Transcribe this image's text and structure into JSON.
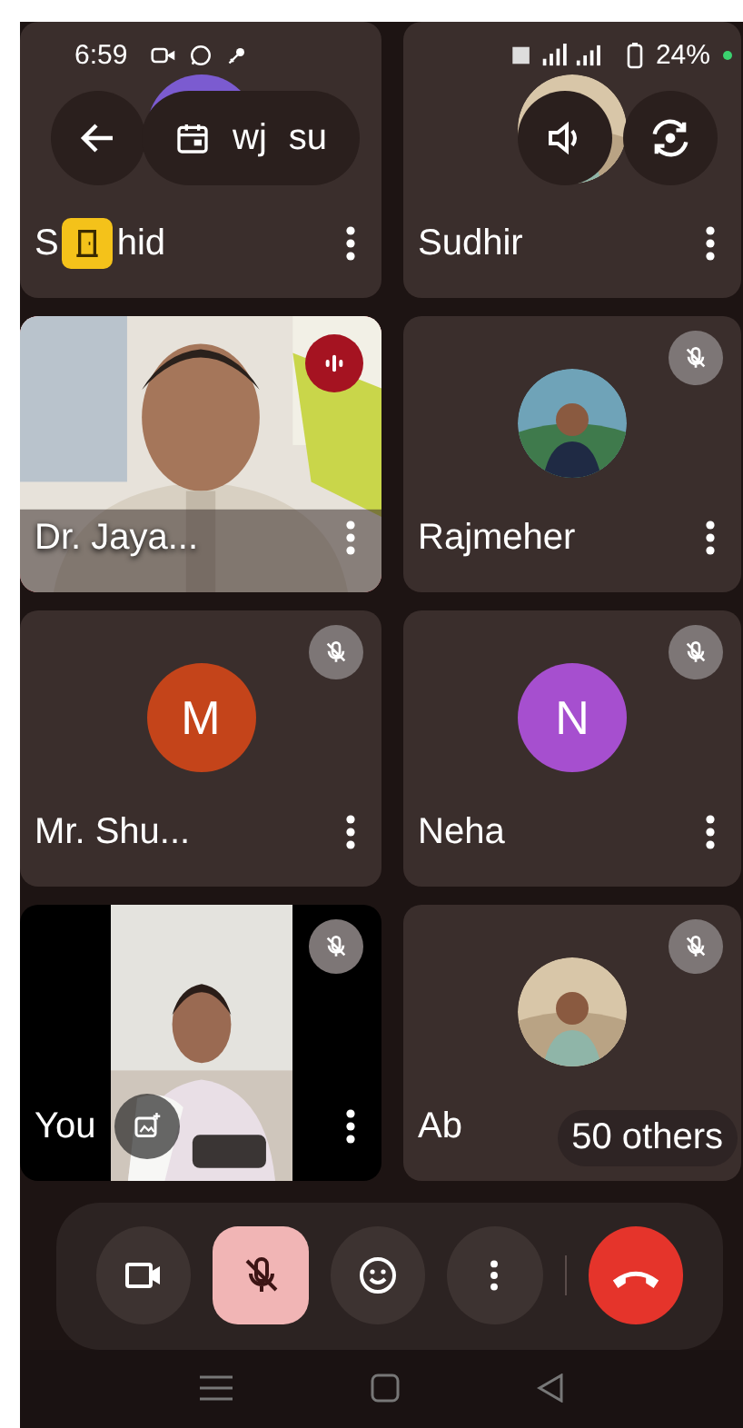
{
  "status_bar": {
    "time": "6:59",
    "battery": "24%"
  },
  "top_bar": {
    "title_parts": [
      "wj",
      "su"
    ]
  },
  "tiles": [
    {
      "name": "S",
      "name_rest": "hid",
      "kind": "color_avatar",
      "color": "#7b5bd0",
      "muted": false,
      "speaking": false,
      "door_badge": true
    },
    {
      "name": "Sudhir",
      "kind": "photo_avatar",
      "muted": false,
      "speaking": false
    },
    {
      "name": "Dr. Jaya...",
      "kind": "video",
      "muted": false,
      "speaking": true
    },
    {
      "name": "Rajmeher",
      "kind": "photo_avatar",
      "muted": true,
      "speaking": false
    },
    {
      "name": "Mr. Shu...",
      "kind": "letter",
      "letter": "M",
      "color": "#c4441a",
      "muted": true,
      "speaking": false
    },
    {
      "name": "Neha",
      "kind": "letter",
      "letter": "N",
      "color": "#a64fcf",
      "muted": true,
      "speaking": false
    },
    {
      "name": "You",
      "kind": "self_video",
      "muted": true,
      "speaking": false
    },
    {
      "name": "Ab",
      "kind": "photo_avatar",
      "muted": true,
      "speaking": false,
      "overlay": "50 others"
    }
  ],
  "controls": [
    {
      "kind": "camera"
    },
    {
      "kind": "mic",
      "muted": true
    },
    {
      "kind": "emoji"
    },
    {
      "kind": "more"
    },
    {
      "kind": "hangup"
    }
  ]
}
